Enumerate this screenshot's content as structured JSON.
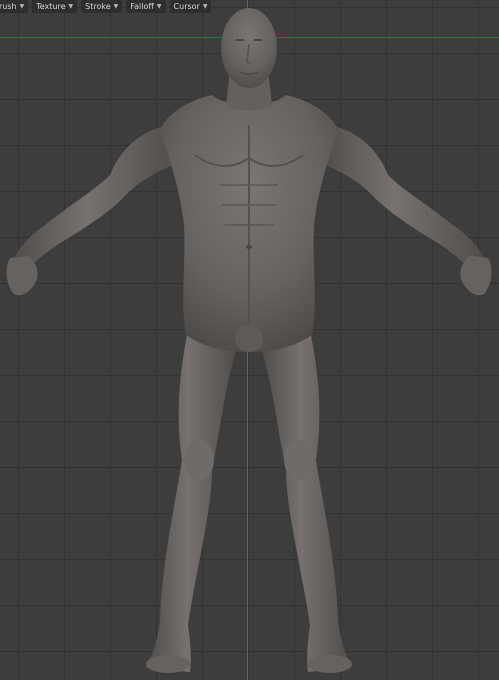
{
  "header": {
    "menus": [
      {
        "label": "rush",
        "icon": "chevron-down-icon"
      },
      {
        "label": "Texture",
        "icon": "chevron-down-icon"
      },
      {
        "label": "Stroke",
        "icon": "chevron-down-icon"
      },
      {
        "label": "Falloff",
        "icon": "chevron-down-icon"
      },
      {
        "label": "Cursor",
        "icon": "chevron-down-icon"
      }
    ]
  },
  "viewport": {
    "background": "#3d3d3d",
    "grid_color": "#333333",
    "x_axis_color": "#a33a3a",
    "y_axis_color": "#3d6aa0",
    "model_color": "#6e6a68"
  }
}
